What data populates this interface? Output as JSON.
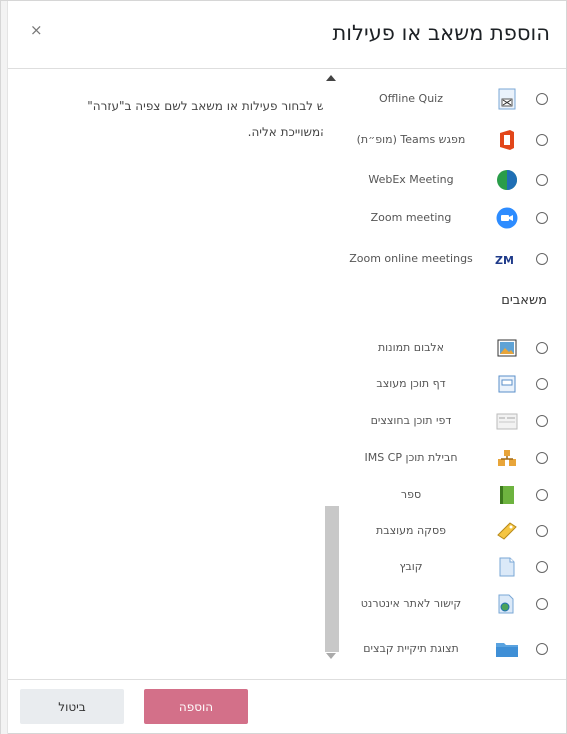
{
  "dialog": {
    "title": "הוספת משאב או פעילות",
    "close_glyph": "×"
  },
  "help_text": "יש לבחור פעילות או משאב לשם צפיה ב\"עזרה\" המשוייכת אליה.",
  "activities": [
    {
      "label": "Offline Quiz",
      "icon": "offline-quiz-icon"
    },
    {
      "label": "מפגש Teams (מופ״ת)",
      "icon": "office-icon"
    },
    {
      "label": "WebEx Meeting",
      "icon": "webex-icon"
    },
    {
      "label": "Zoom meeting",
      "icon": "zoom-meeting-icon"
    },
    {
      "label": "Zoom online meetings",
      "icon": "zoom-online-icon"
    }
  ],
  "resources_header": "משאבים",
  "resources": [
    {
      "label": "אלבום תמונות",
      "icon": "image-album-icon"
    },
    {
      "label": "דף תוכן מעוצב",
      "icon": "page-icon"
    },
    {
      "label": "דפי תוכן בחוצצים",
      "icon": "tabs-icon"
    },
    {
      "label": "חבילת תוכן IMS CP",
      "icon": "ims-package-icon"
    },
    {
      "label": "ספר",
      "icon": "book-icon"
    },
    {
      "label": "פסקה מעוצבת",
      "icon": "label-icon"
    },
    {
      "label": "קובץ",
      "icon": "file-icon"
    },
    {
      "label": "קישור לאתר אינטרנט",
      "icon": "url-icon"
    },
    {
      "label": "תצוגת תיקיית קבצים",
      "icon": "folder-icon"
    }
  ],
  "footer": {
    "add_label": "הוספה",
    "cancel_label": "ביטול"
  },
  "colors": {
    "primary": "#d37089",
    "secondary": "#e9ecef"
  }
}
